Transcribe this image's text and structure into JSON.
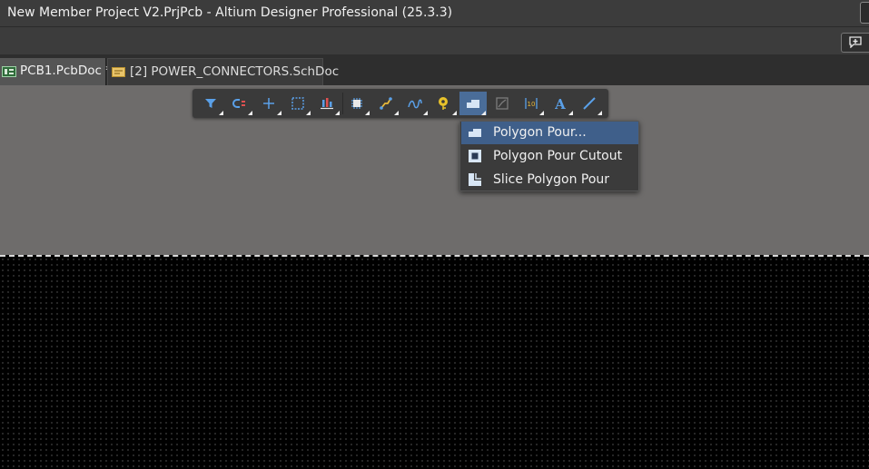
{
  "window": {
    "title": "New Member Project V2.PrjPcb - Altium Designer Professional (25.3.3)"
  },
  "tabs": [
    {
      "label": "PCB1.PcbDoc *",
      "icon": "pcb-doc-icon",
      "active": true
    },
    {
      "label": "[2] POWER_CONNECTORS.SchDoc",
      "icon": "schematic-doc-icon",
      "active": false
    }
  ],
  "active_bar": {
    "tools": [
      {
        "name": "filter-icon",
        "has_dropdown": true
      },
      {
        "name": "interactive-routing-snap-icon",
        "has_dropdown": true
      },
      {
        "name": "crosshair-icon",
        "has_dropdown": true
      },
      {
        "name": "select-rectangle-icon",
        "has_dropdown": true
      },
      {
        "name": "align-icon",
        "has_dropdown": true
      },
      {
        "name": "component-icon",
        "has_dropdown": true
      },
      {
        "name": "route-icon",
        "has_dropdown": true
      },
      {
        "name": "diff-pair-icon",
        "has_dropdown": true
      },
      {
        "name": "via-pad-icon",
        "has_dropdown": true
      },
      {
        "name": "polygon-pour-icon",
        "has_dropdown": true,
        "active": true
      },
      {
        "name": "region-icon",
        "has_dropdown": false
      },
      {
        "name": "dimension-icon",
        "has_dropdown": true
      },
      {
        "name": "text-icon",
        "has_dropdown": true
      },
      {
        "name": "line-icon",
        "has_dropdown": true
      }
    ]
  },
  "polygon_menu": {
    "items": [
      {
        "label": "Polygon Pour...",
        "icon": "polygon-pour-icon",
        "selected": true
      },
      {
        "label": "Polygon Pour Cutout",
        "icon": "polygon-cutout-icon",
        "selected": false
      },
      {
        "label": "Slice Polygon Pour",
        "icon": "slice-polygon-icon",
        "selected": false
      }
    ]
  },
  "colors": {
    "toolbar_bg": "#3a3a3a",
    "menu_highlight": "#3f5f8a",
    "sheet": "#6e6c6b",
    "board": "#000000"
  }
}
